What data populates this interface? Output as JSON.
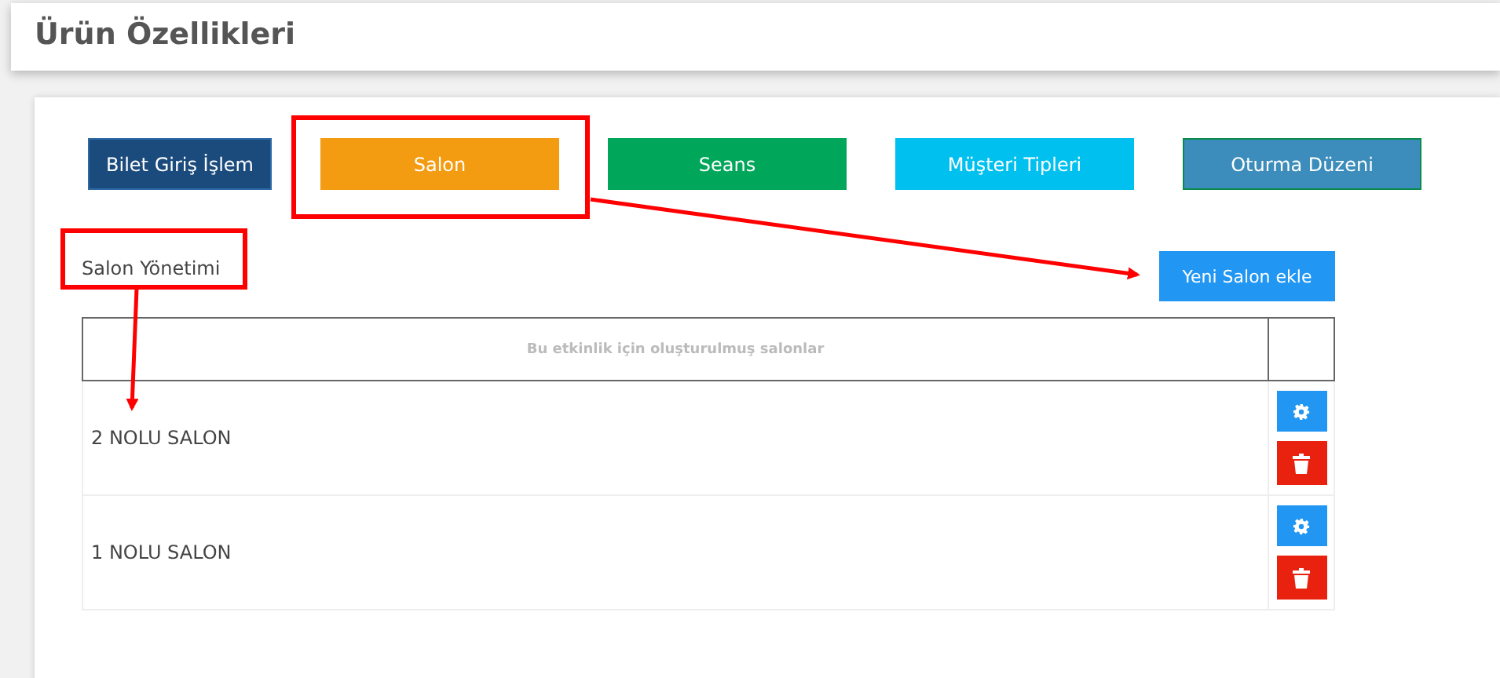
{
  "page_title": "Ürün Özellikleri",
  "tabs": [
    {
      "label": "Bilet Giriş İşlem",
      "color": "#1b4a7c"
    },
    {
      "label": "Salon",
      "color": "#f39c12"
    },
    {
      "label": "Seans",
      "color": "#00a65a"
    },
    {
      "label": "Müşteri Tipleri",
      "color": "#00c0ef"
    },
    {
      "label": "Oturma Düzeni",
      "color": "#3c8dbc"
    }
  ],
  "section_title": "Salon Yönetimi",
  "add_button": "Yeni Salon ekle",
  "table": {
    "columns": [
      "Bu etkinlik için oluşturulmuş salonlar"
    ],
    "rows": [
      {
        "name": "2 NOLU SALON"
      },
      {
        "name": "1 NOLU SALON"
      }
    ]
  }
}
